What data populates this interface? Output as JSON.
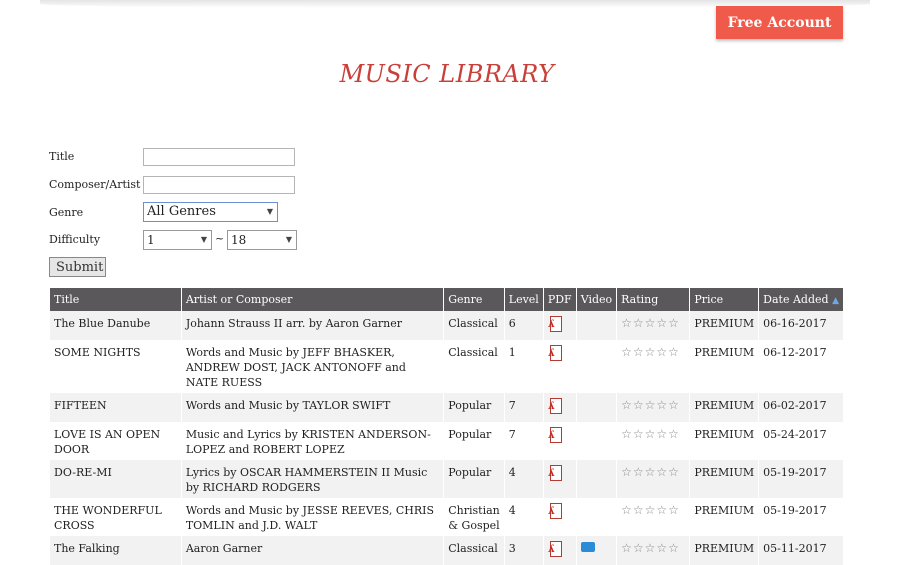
{
  "header": {
    "free_account": "Free Account",
    "page_title": "MUSIC LIBRARY"
  },
  "search_form": {
    "title_label": "Title",
    "title_value": "",
    "composer_label": "Composer/Artist",
    "composer_value": "",
    "genre_label": "Genre",
    "genre_selected": "All Genres",
    "difficulty_label": "Difficulty",
    "difficulty_min": "1",
    "difficulty_separator": "~",
    "difficulty_max": "18",
    "submit_label": "Submit"
  },
  "table": {
    "columns": [
      "Title",
      "Artist or Composer",
      "Genre",
      "Level",
      "PDF",
      "Video",
      "Rating",
      "Price",
      "Date Added"
    ],
    "sort_indicator": "▲",
    "rating_stars": "☆☆☆☆☆",
    "rows": [
      {
        "title": "The Blue Danube",
        "artist": "Johann Strauss II arr. by Aaron Garner",
        "genre": "Classical",
        "level": "6",
        "price": "PREMIUM",
        "date": "06-16-2017"
      },
      {
        "title": "SOME NIGHTS",
        "artist": "Words and Music by JEFF BHASKER, ANDREW DOST, JACK ANTONOFF and NATE RUESS",
        "genre": "Classical",
        "level": "1",
        "price": "PREMIUM",
        "date": "06-12-2017"
      },
      {
        "title": "FIFTEEN",
        "artist": "Words and Music by TAYLOR SWIFT",
        "genre": "Popular",
        "level": "7",
        "price": "PREMIUM",
        "date": "06-02-2017"
      },
      {
        "title": "LOVE IS AN OPEN DOOR",
        "artist": "Music and Lyrics by KRISTEN ANDERSON-LOPEZ and ROBERT LOPEZ",
        "genre": "Popular",
        "level": "7",
        "price": "PREMIUM",
        "date": "05-24-2017"
      },
      {
        "title": "DO-RE-MI",
        "artist": "Lyrics by OSCAR HAMMERSTEIN II Music by RICHARD RODGERS",
        "genre": "Popular",
        "level": "4",
        "price": "PREMIUM",
        "date": "05-19-2017"
      },
      {
        "title": "THE WONDERFUL CROSS",
        "artist": "Words and Music by JESSE REEVES, CHRIS TOMLIN and J.D. WALT",
        "genre": "Christian & Gospel",
        "level": "4",
        "price": "PREMIUM",
        "date": "05-19-2017"
      },
      {
        "title": "The Falking",
        "artist": "Aaron Garner",
        "genre": "Classical",
        "level": "3",
        "price": "PREMIUM",
        "date": "05-11-2017"
      }
    ]
  },
  "colors": {
    "accent": "#f05a4b",
    "title_red": "#c9403b",
    "header_bg": "#5a585a"
  }
}
